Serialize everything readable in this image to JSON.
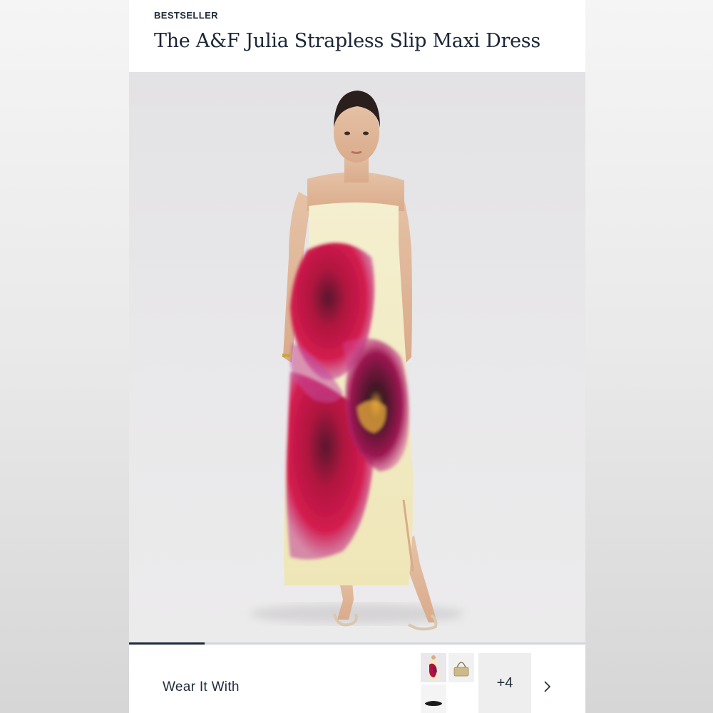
{
  "product": {
    "badge": "BESTSELLER",
    "title": "The A&F Julia Strapless Slip Maxi Dress"
  },
  "gallery": {
    "image_alt": "Model wearing strapless slip maxi dress with large magenta flower print",
    "progress_fraction": 0.166
  },
  "wear_it_with": {
    "label": "Wear It With",
    "more_count": "+4",
    "thumbnails": [
      "dress-thumbnail",
      "bag-thumbnail",
      "sandal-thumbnail",
      "blank-thumbnail"
    ]
  },
  "colors": {
    "text_primary": "#1f2a3a",
    "dress_base": "#f2ecc4",
    "flower_magenta": "#c4164a",
    "flower_purple": "#8e1f6a"
  }
}
